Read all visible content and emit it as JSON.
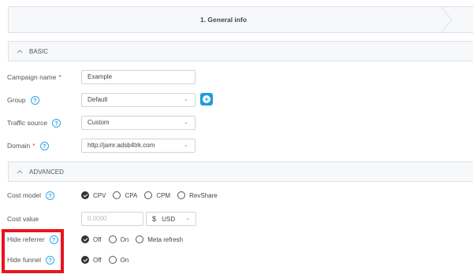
{
  "wizard": {
    "step_title": "1. General info"
  },
  "sections": {
    "basic": "BASIC",
    "advanced": "ADVANCED"
  },
  "fields": {
    "campaign_name": {
      "label": "Campaign name",
      "required": "*",
      "value": "Example"
    },
    "group": {
      "label": "Group",
      "value": "Default"
    },
    "traffic_source": {
      "label": "Traffic source",
      "value": "Custom"
    },
    "domain": {
      "label": "Domain",
      "required": "*",
      "value": "http://jamr.adsb4trk.com"
    },
    "cost_model": {
      "label": "Cost model",
      "options": [
        "CPV",
        "CPA",
        "CPM",
        "RevShare"
      ],
      "selected": "CPV"
    },
    "cost_value": {
      "label": "Cost value",
      "placeholder": "0.0000",
      "currency_symbol": "$",
      "currency": "USD"
    },
    "hide_referrer": {
      "label": "Hide referrer",
      "options": [
        "Off",
        "On",
        "Meta refresh"
      ],
      "selected": "Off"
    },
    "hide_funnel": {
      "label": "Hide funnel",
      "options": [
        "Off",
        "On"
      ],
      "selected": "Off"
    }
  },
  "icons": {
    "help": "?",
    "chevron_up": "^",
    "chevron_down": "⌄",
    "add": "+"
  },
  "colors": {
    "accent": "#1e9be0",
    "required": "#e53935",
    "highlight": "#e8141c"
  }
}
